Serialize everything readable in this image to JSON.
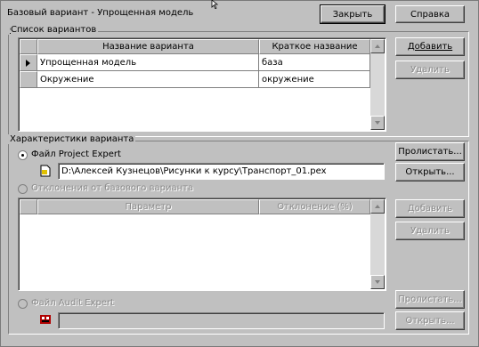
{
  "window": {
    "title": "Базовый вариант - Упрощенная модель",
    "close_button": "Закрыть",
    "help_button": "Справка"
  },
  "variants": {
    "group_label": "Список вариантов",
    "columns": [
      "Название варианта",
      "Краткое название"
    ],
    "rows": [
      {
        "name": "Упрощенная модель",
        "short": "база"
      },
      {
        "name": "Окружение",
        "short": "окружение"
      }
    ],
    "add_button": "Добавить",
    "delete_button": "Удалить"
  },
  "characteristics": {
    "group_label": "Характеристики варианта",
    "project_expert_label": "Файл Project Expert",
    "project_expert_path": "D:\\Алексей Кузнецов\\Рисунки к курсу\\Транспорт_01.pex",
    "browse_button": "Пролистать...",
    "open_button": "Открыть...",
    "deviations_label": "Отклонения от базового варианта",
    "deviation_columns": [
      "Параметр",
      "Отклонение (%)"
    ],
    "dev_add_button": "Добавить",
    "dev_delete_button": "Удалить",
    "audit_expert_label": "Файл Audit Expert",
    "audit_expert_path": "",
    "audit_browse_button": "Пролистать...",
    "audit_open_button": "Открыть..."
  },
  "icons": {
    "file_icon": "file-icon",
    "audit_icon": "audit-expert-icon",
    "cursor": "mouse-cursor-icon"
  }
}
